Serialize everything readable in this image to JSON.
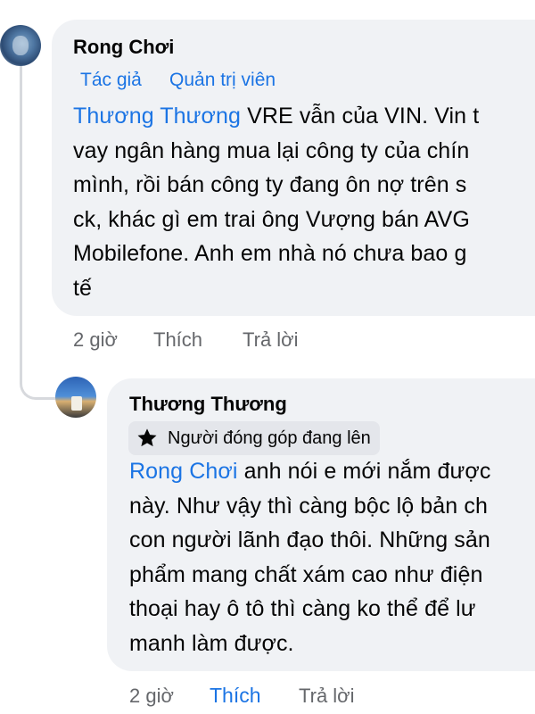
{
  "comment": {
    "author": "Rong Chơi",
    "badges": [
      "Tác giả",
      "Quản trị viên"
    ],
    "mention": "Thương Thương",
    "lines": [
      " VRE vẫn của VIN. Vin t",
      "vay ngân hàng mua lại công ty của chín",
      "mình, rồi bán công ty đang ôn nợ trên s",
      "ck, khác gì em trai ông Vượng bán AVG",
      "Mobilefone. Anh em nhà nó chưa bao g",
      "tế"
    ],
    "time": "2 giờ",
    "like_label": "Thích",
    "reply_label": "Trả lời"
  },
  "reply": {
    "author": "Thương Thương",
    "badge": "Người đóng góp đang lên",
    "badge_icon": "star-icon",
    "mention": "Rong Chơi",
    "lines": [
      " anh nói e mới nắm được",
      "này. Như vậy thì càng bộc lộ bản ch",
      "con người lãnh đạo thôi. Những sản",
      "phẩm mang chất xám cao như điện",
      "thoại hay ô tô thì càng ko thể để lư",
      "manh làm được."
    ],
    "time": "2 giờ",
    "like_label": "Thích",
    "reply_label": "Trả lời",
    "liked_color": "#1b74e4"
  },
  "colors": {
    "bubble": "#f0f2f5",
    "link": "#1b74e4",
    "meta": "#65676b",
    "text": "#050505"
  }
}
